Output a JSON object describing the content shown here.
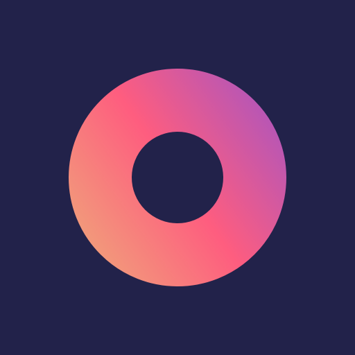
{
  "colors": {
    "background": "#22224a",
    "gradient_start": "#f0a27a",
    "gradient_mid": "#fe5d7f",
    "gradient_end": "#ad55bd"
  },
  "icon": {
    "name": "ring-logo-icon"
  }
}
